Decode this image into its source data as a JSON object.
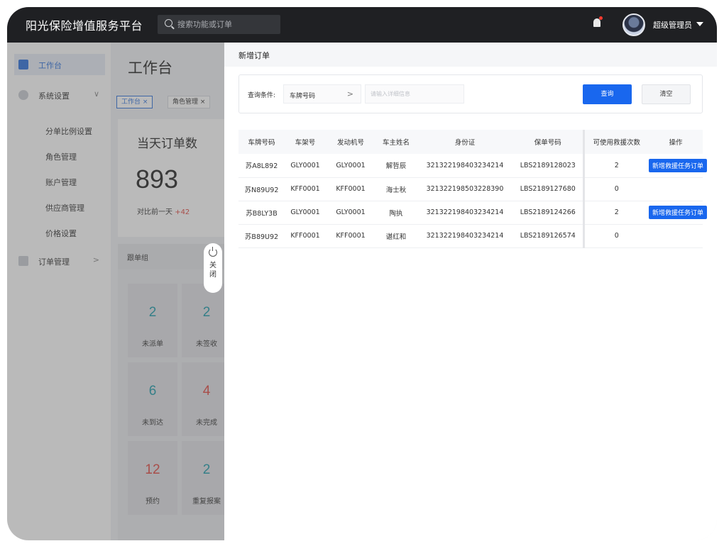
{
  "header": {
    "brand": "阳光保险增值服务平台",
    "search_placeholder": "搜索功能或订单",
    "user_name": "超级管理员"
  },
  "sidebar": {
    "items": [
      {
        "label": "工作台",
        "icon": "monitor-icon",
        "active": true
      },
      {
        "label": "系统设置",
        "icon": "gear-icon",
        "chevron": "∨"
      },
      {
        "label": "订单管理",
        "icon": "document-icon",
        "chevron": ">"
      }
    ],
    "sub_items": [
      "分单比例设置",
      "角色管理",
      "账户管理",
      "供应商管理",
      "价格设置"
    ]
  },
  "main": {
    "title": "工作台",
    "tabs": [
      {
        "label": "工作台 ×",
        "active": true
      },
      {
        "label": "角色管理 ×",
        "active": false
      }
    ],
    "orders_card": {
      "title": "当天订单数",
      "count": "893",
      "compare_label": "对比前一天",
      "compare_delta": "+42"
    },
    "group": {
      "title": "跟单组",
      "stats": [
        {
          "value": "2",
          "label": "未派单",
          "color": "#1b9aaa"
        },
        {
          "value": "2",
          "label": "未签收",
          "color": "#1b9aaa"
        },
        {
          "value": "6",
          "label": "未到达",
          "color": "#1b9aaa"
        },
        {
          "value": "4",
          "label": "未完成",
          "color": "#e0463f"
        },
        {
          "value": "12",
          "label": "预约",
          "color": "#e0463f"
        },
        {
          "value": "2",
          "label": "重复报案",
          "color": "#1b9aaa"
        }
      ]
    },
    "close_toggle": {
      "label": "关\n闭"
    }
  },
  "drawer": {
    "title": "新增订单",
    "query": {
      "label": "查询条件:",
      "selected": "车牌号码",
      "chevron": ">",
      "input_placeholder": "请输入详细信息",
      "search_button": "查询",
      "clear_button": "清空"
    },
    "table": {
      "columns": [
        "车牌号码",
        "车架号",
        "发动机号",
        "车主姓名",
        "身份证",
        "保单号码",
        "可使用救援次数",
        "操作"
      ],
      "rows": [
        {
          "plate": "苏A8L892",
          "frame": "GLY0001",
          "engine": "GLY0001",
          "owner": "解哲辰",
          "id_card": "321322198403234214",
          "policy": "LBS2189128023",
          "count": "2",
          "action": "新增救援任务订单"
        },
        {
          "plate": "苏N89U92",
          "frame": "KFF0001",
          "engine": "KFF0001",
          "owner": "海士秋",
          "id_card": "321322198503228390",
          "policy": "LBS2189127680",
          "count": "0",
          "action": ""
        },
        {
          "plate": "苏B8LY3B",
          "frame": "GLY0001",
          "engine": "GLY0001",
          "owner": "陶执",
          "id_card": "321322198403234214",
          "policy": "LBS2189124266",
          "count": "2",
          "action": "新增救援任务订单"
        },
        {
          "plate": "苏B89U92",
          "frame": "KFF0001",
          "engine": "KFF0001",
          "owner": "谌红和",
          "id_card": "321322198403234214",
          "policy": "LBS2189126574",
          "count": "0",
          "action": ""
        }
      ]
    }
  }
}
